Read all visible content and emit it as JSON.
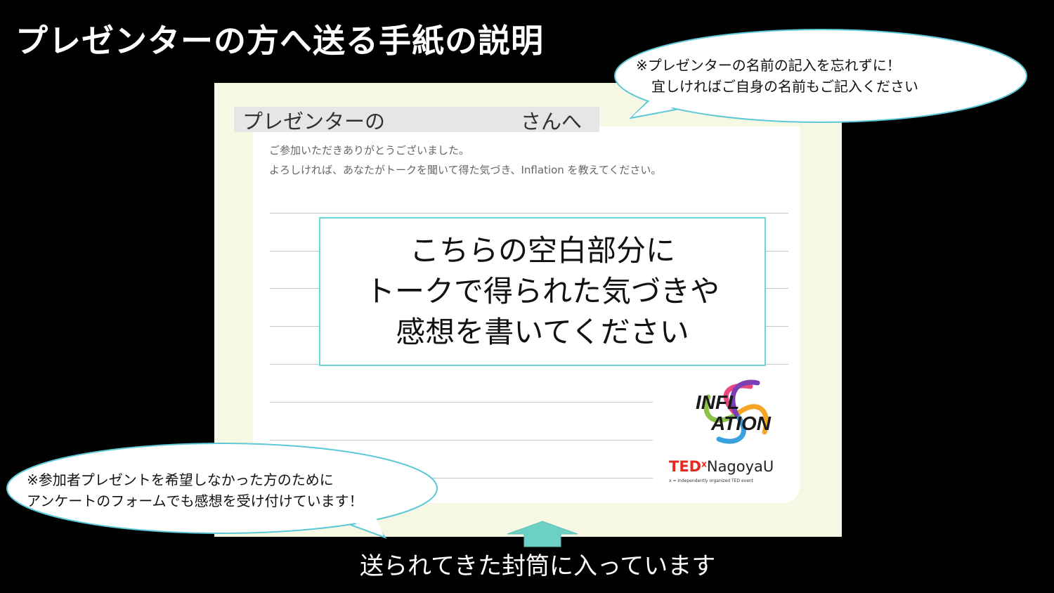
{
  "title": "プレゼンターの方へ送る手紙の説明",
  "letter": {
    "addressee_prefix": "プレゼンターの",
    "addressee_suffix": "さんへ",
    "intro_line1": "ご参加いただきありがとうございました。",
    "intro_line2": "よろしければ、あなたがトークを聞いて得た気づき、Inflation を教えてください。"
  },
  "instruction": {
    "line1": "こちらの空白部分に",
    "line2": "トークで得られた気づきや",
    "line3": "感想を書いてください"
  },
  "note_top": {
    "line1": "※プレゼンターの名前の記入を忘れずに！",
    "line2": "宜しければご自身の名前もご記入ください"
  },
  "note_bottom": {
    "line1": "※参加者プレゼントを希望しなかった方のために",
    "line2": "アンケートのフォームでも感想を受け付けています！"
  },
  "caption": "送られてきた封筒に入っています",
  "logo": {
    "inflation_line1": "INFL",
    "inflation_line2": "ATION",
    "ted": "TED",
    "x": "x",
    "event": "NagoyaU",
    "tagline": "x = independently organized TED event"
  },
  "colors": {
    "background": "#000000",
    "sheet": "#f7f8e4",
    "box_border": "#6bd6d6",
    "bubble_border": "#5cc8d8",
    "ted_red": "#e62b1e"
  }
}
